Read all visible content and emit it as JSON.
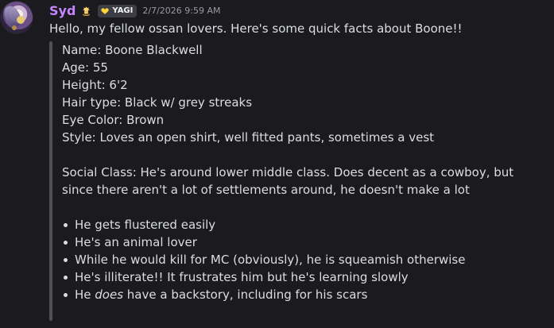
{
  "message": {
    "author": {
      "name": "Syd",
      "accent_color": "#c786ff",
      "avatar_icon": "character-avatar-icon",
      "hat_icon": "hat-icon",
      "tag": {
        "icon": "yellow-heart-icon",
        "label": "YAGI"
      }
    },
    "timestamp": "2/7/2026 9:59 AM",
    "intro": "Hello, my fellow ossan lovers. Here's some quick facts about Boone!!",
    "quote": {
      "lines": [
        "Name: Boone Blackwell",
        "Age: 55",
        "Height: 6'2",
        "Hair type: Black w/ grey streaks",
        "Eye Color: Brown",
        "Style: Loves an open shirt, well fitted pants, sometimes a vest"
      ],
      "social_class": "Social Class: He's around lower middle class. Does decent as a cowboy, but since there aren't a lot of settlements around, he doesn't make a lot",
      "bullets": [
        "He gets flustered easily",
        "He's an animal lover",
        "While he would kill for MC (obviously), he is squeamish otherwise",
        "He's illiterate!! It frustrates him but he's learning slowly"
      ],
      "last_bullet": {
        "prefix": "He ",
        "emphasis": "does",
        "suffix": " have a backstory, including for his scars"
      }
    }
  }
}
